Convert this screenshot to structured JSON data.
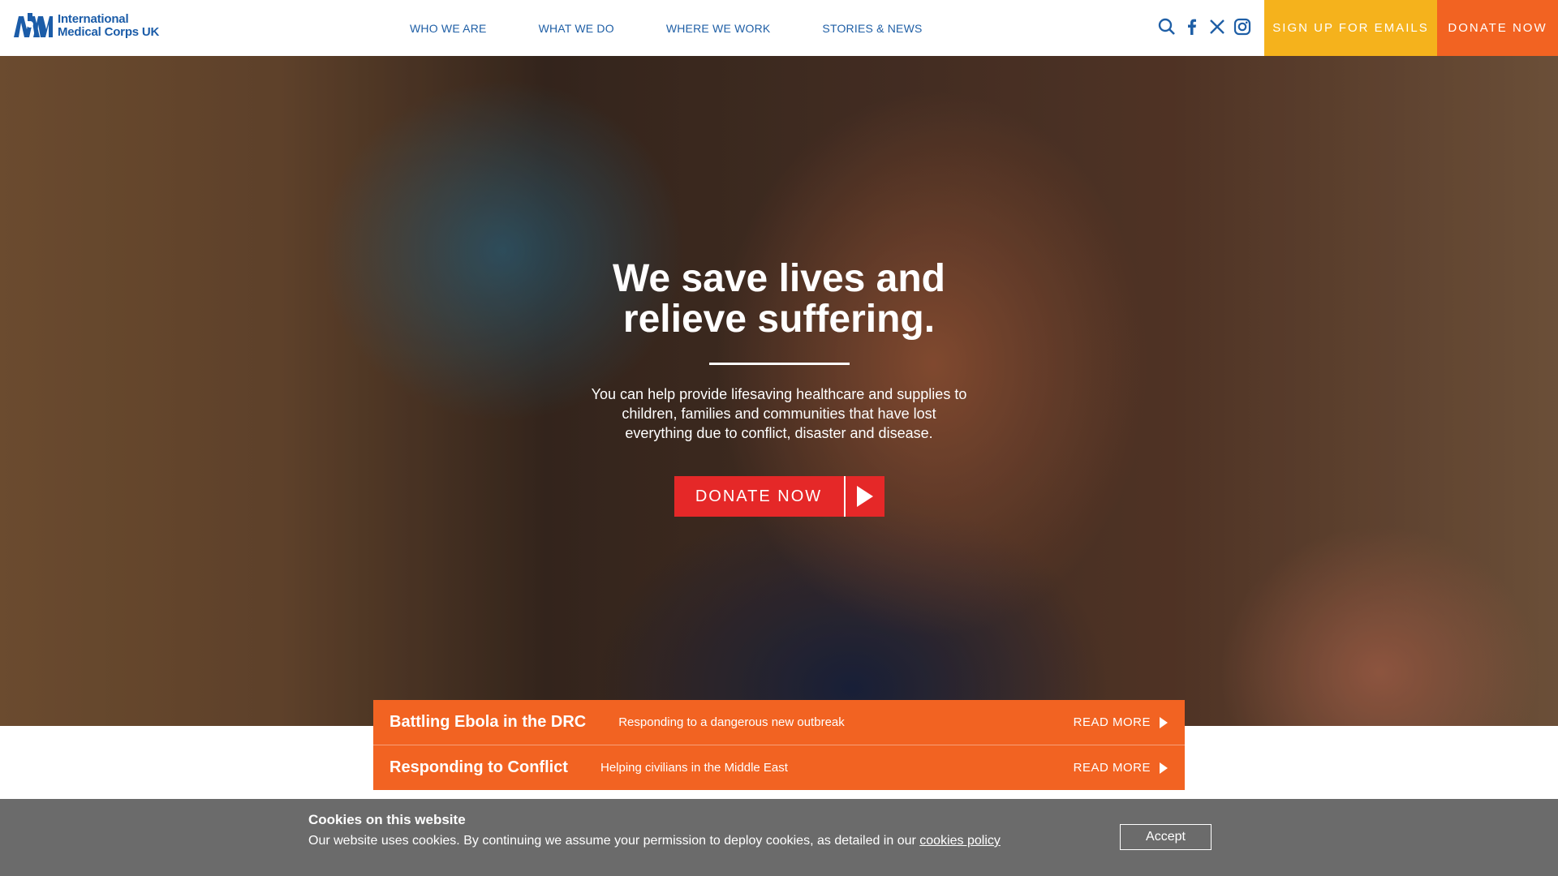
{
  "brand": {
    "logo_line1": "International",
    "logo_line2": "Medical Corps UK",
    "color": "#1b5ca8"
  },
  "nav": {
    "items": [
      "WHO WE ARE",
      "WHAT WE DO",
      "WHERE WE WORK",
      "STORIES & NEWS"
    ]
  },
  "header_icons": [
    "search-icon",
    "facebook-icon",
    "x-icon",
    "instagram-icon"
  ],
  "header_buttons": {
    "signup": "SIGN UP FOR EMAILS",
    "donate": "DONATE NOW",
    "signup_color": "#f5b21c",
    "donate_color": "#f26322"
  },
  "hero": {
    "title_line1": "We save lives and",
    "title_line2": "relieve suffering.",
    "text": "You can help provide lifesaving healthcare and supplies to children, families and communities that have lost everything due to conflict, disaster and disease.",
    "cta": "DONATE NOW",
    "cta_color": "#e52828"
  },
  "stories": [
    {
      "title": "Battling Ebola in the DRC",
      "subtitle": "Responding to a dangerous new outbreak",
      "more": "READ MORE"
    },
    {
      "title": "Responding to Conflict",
      "subtitle": "Helping civilians in the Middle East",
      "more": "READ MORE"
    }
  ],
  "cookie": {
    "title": "Cookies on this website",
    "text": "Our website uses cookies. By continuing we assume your permission to deploy cookies, as detailed in our",
    "link": "cookies policy",
    "accept": "Accept"
  }
}
